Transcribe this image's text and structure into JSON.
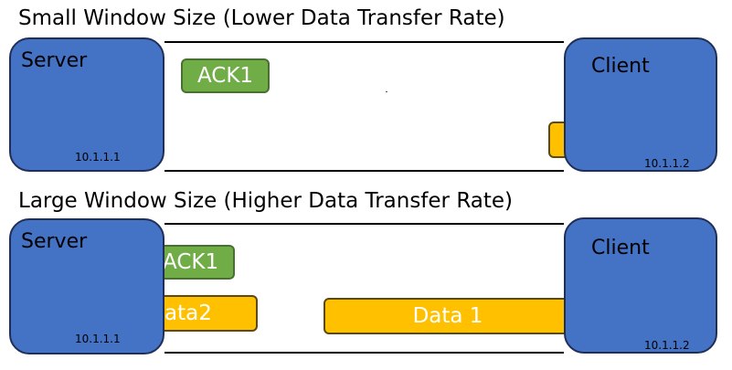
{
  "panels": [
    {
      "title": "Small Window Size (Lower Data Transfer Rate)",
      "server": {
        "name": "Server",
        "ip": "10.1.1.1"
      },
      "client": {
        "name": "Client",
        "ip": "10.1.1.2"
      },
      "ack_label": "ACK1"
    },
    {
      "title": "Large Window Size (Higher Data Transfer Rate)",
      "server": {
        "name": "Server",
        "ip": "10.1.1.1"
      },
      "client": {
        "name": "Client",
        "ip": "10.1.1.2"
      },
      "ack_label": "ACK1",
      "data2_label": "ata2",
      "data1_label": "Data 1"
    }
  ],
  "colors": {
    "host_fill": "#4472c4",
    "ack_fill": "#70ad47",
    "data_fill": "#ffc000"
  }
}
